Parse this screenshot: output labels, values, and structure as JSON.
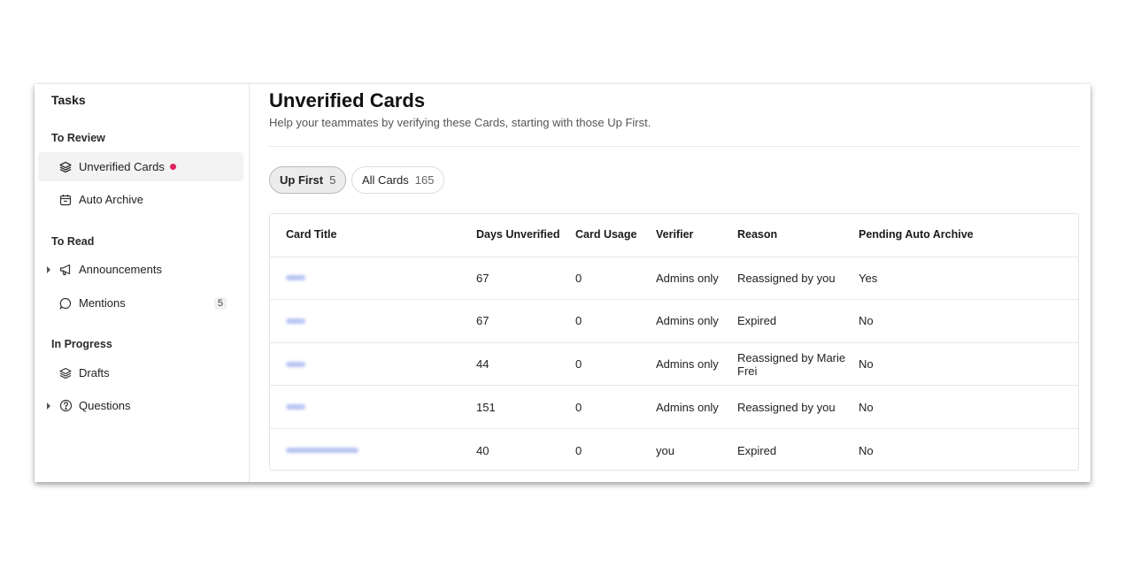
{
  "sidebar": {
    "title": "Tasks",
    "sections": {
      "to_review": "To Review",
      "to_read": "To Read",
      "in_progress": "In Progress"
    },
    "items": {
      "unverified_cards": {
        "label": "Unverified Cards",
        "icon": "stack-icon",
        "has_dot": true,
        "active": true
      },
      "auto_archive": {
        "label": "Auto Archive",
        "icon": "calendar-icon"
      },
      "announcements": {
        "label": "Announcements",
        "icon": "megaphone-icon",
        "expandable": true
      },
      "mentions": {
        "label": "Mentions",
        "icon": "chat-bubble-icon",
        "count": "5"
      },
      "drafts": {
        "label": "Drafts",
        "icon": "stack-icon"
      },
      "questions": {
        "label": "Questions",
        "icon": "question-circle-icon",
        "expandable": true
      }
    }
  },
  "main": {
    "title": "Unverified Cards",
    "subtitle": "Help your teammates by verifying these Cards, starting with those Up First.",
    "tabs": [
      {
        "label": "Up First",
        "count": "5",
        "active": true
      },
      {
        "label": "All Cards",
        "count": "165",
        "active": false
      }
    ],
    "table": {
      "columns": [
        "Card Title",
        "Days Unverified",
        "Card Usage",
        "Verifier",
        "Reason",
        "Pending Auto Archive"
      ],
      "rows": [
        {
          "days": "67",
          "usage": "0",
          "verifier": "Admins only",
          "reason": "Reassigned by you",
          "pending": "Yes"
        },
        {
          "days": "67",
          "usage": "0",
          "verifier": "Admins only",
          "reason": "Expired",
          "pending": "No"
        },
        {
          "days": "44",
          "usage": "0",
          "verifier": "Admins only",
          "reason": "Reassigned by Marie Frei",
          "pending": "No"
        },
        {
          "days": "151",
          "usage": "0",
          "verifier": "Admins only",
          "reason": "Reassigned by you",
          "pending": "No"
        },
        {
          "days": "40",
          "usage": "0",
          "verifier": "you",
          "reason": "Expired",
          "pending": "No"
        }
      ]
    }
  },
  "colors": {
    "accent_dot": "#e0245e",
    "link_blur": "#b8c4f4"
  }
}
